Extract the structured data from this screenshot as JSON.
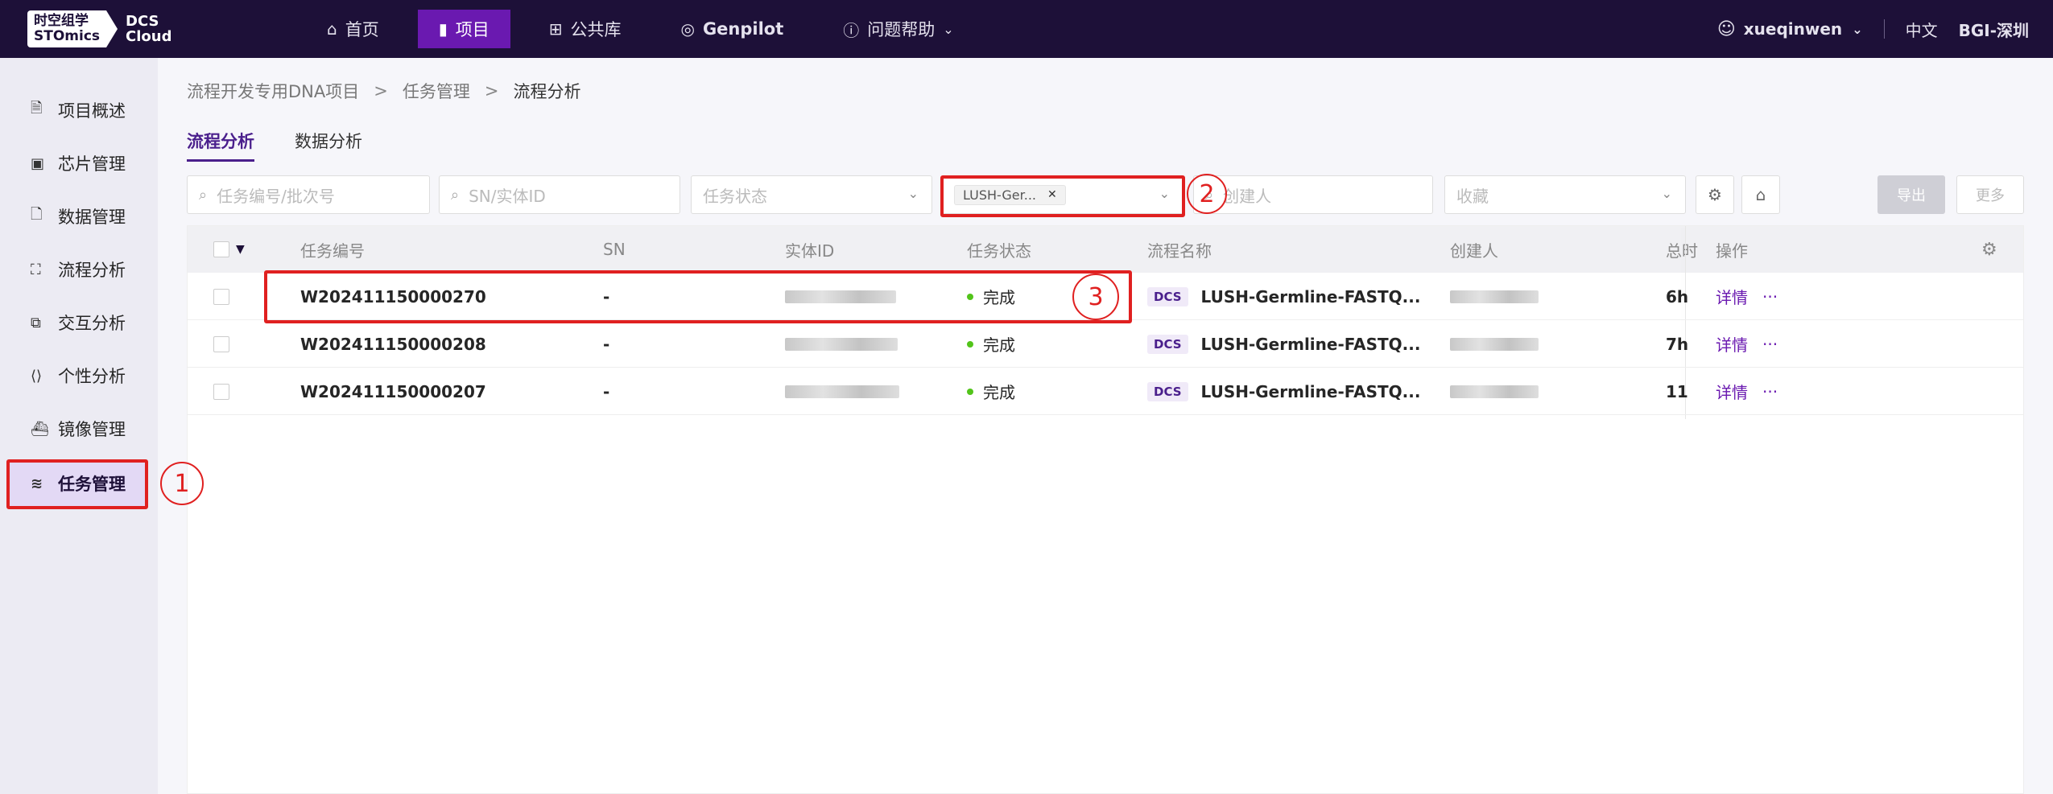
{
  "logo": {
    "line1": "时空组学",
    "line2": "STOmics",
    "product1": "DCS",
    "product2": "Cloud"
  },
  "nav": [
    {
      "label": "首页",
      "icon": "home-icon"
    },
    {
      "label": "项目",
      "icon": "file-icon",
      "active": true
    },
    {
      "label": "公共库",
      "icon": "grid-icon"
    },
    {
      "label": "Genpilot",
      "icon": "globe-icon"
    },
    {
      "label": "问题帮助",
      "icon": "help-icon"
    }
  ],
  "user": {
    "name": "xueqinwen",
    "lang": "中文",
    "region": "BGI-深圳"
  },
  "sidebar": [
    {
      "label": "项目概述",
      "icon": "document-icon"
    },
    {
      "label": "芯片管理",
      "icon": "chip-icon"
    },
    {
      "label": "数据管理",
      "icon": "data-file-icon"
    },
    {
      "label": "流程分析",
      "icon": "workflow-icon"
    },
    {
      "label": "交互分析",
      "icon": "interactive-icon"
    },
    {
      "label": "个性分析",
      "icon": "code-icon"
    },
    {
      "label": "镜像管理",
      "icon": "docker-icon"
    },
    {
      "label": "任务管理",
      "icon": "layers-icon",
      "active": true
    }
  ],
  "breadcrumb": {
    "project": "流程开发专用DNA项目",
    "section": "任务管理",
    "current": "流程分析",
    "separator": ">"
  },
  "tabs": [
    {
      "label": "流程分析",
      "active": true
    },
    {
      "label": "数据分析"
    }
  ],
  "filters": {
    "task_id_placeholder": "任务编号/批次号",
    "sn_placeholder": "SN/实体ID",
    "status_placeholder": "任务状态",
    "workflow_tag": "LUSH-Ger...",
    "creator_placeholder": "创建人",
    "favorite_placeholder": "收藏",
    "export_label": "导出",
    "more_label": "更多"
  },
  "table": {
    "columns": {
      "task_id": "任务编号",
      "sn": "SN",
      "entity_id": "实体ID",
      "status": "任务状态",
      "workflow": "流程名称",
      "creator": "创建人",
      "duration": "总时",
      "ops": "操作"
    },
    "rows": [
      {
        "task_id": "W202411150000270",
        "sn": "-",
        "status": "完成",
        "badge": "DCS",
        "workflow": "LUSH-Germline-FASTQ...",
        "duration": "6h",
        "detail": "详情",
        "more": "···"
      },
      {
        "task_id": "W202411150000208",
        "sn": "-",
        "status": "完成",
        "badge": "DCS",
        "workflow": "LUSH-Germline-FASTQ...",
        "duration": "7h",
        "detail": "详情",
        "more": "···"
      },
      {
        "task_id": "W202411150000207",
        "sn": "-",
        "status": "完成",
        "badge": "DCS",
        "workflow": "LUSH-Germline-FASTQ...",
        "duration": "11",
        "detail": "详情",
        "more": "···"
      }
    ]
  },
  "annotations": [
    "1",
    "2",
    "3"
  ],
  "colors": {
    "topbar": "#1d1038",
    "accent": "#6a19b0",
    "annotation": "#e02020",
    "status_done": "#52c41a"
  }
}
